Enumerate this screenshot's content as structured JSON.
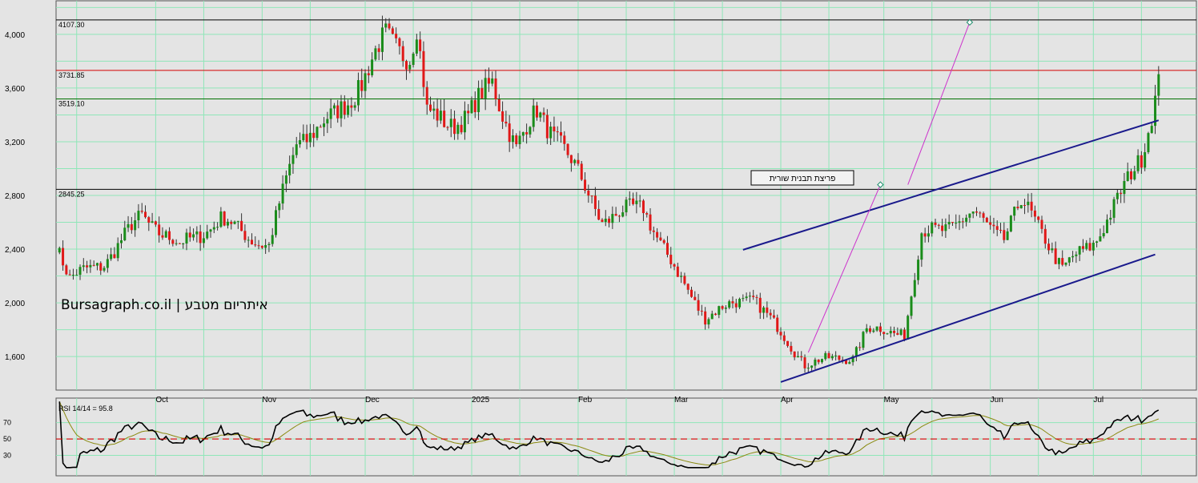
{
  "chart_data": [
    {
      "type": "candlestick",
      "title": "",
      "watermark": "Bursagraph.co.il | איתריום מטבע",
      "annotation": "פריצת תבנית שורית",
      "y_ticks": [
        "4,000",
        "3,600",
        "3,200",
        "2,800",
        "2,400",
        "2,000",
        "1,600"
      ],
      "y_tick_values": [
        4000,
        3600,
        3200,
        2800,
        2400,
        2000,
        1600
      ],
      "ylim": [
        1350,
        4250
      ],
      "x_labels": [
        "Oct",
        "Nov",
        "Dec",
        "2025",
        "Feb",
        "Mar",
        "Apr",
        "May",
        "Jun",
        "Jul"
      ],
      "x_label_dates": [
        "2024-10-01",
        "2024-11-01",
        "2024-12-01",
        "2025-01-01",
        "2025-02-01",
        "2025-03-01",
        "2025-04-01",
        "2025-05-01",
        "2025-06-01",
        "2025-07-01"
      ],
      "xlim": [
        "2024-09-02",
        "2025-07-31"
      ],
      "grid": true,
      "levels": [
        {
          "label": "4107.30",
          "value": 4107.3,
          "color": "#000000"
        },
        {
          "label": "3731.85",
          "value": 3731.85,
          "color": "#d40000"
        },
        {
          "label": "3519.10",
          "value": 3519.1,
          "color": "#007000"
        },
        {
          "label": "2845.25",
          "value": 2845.25,
          "color": "#000000"
        }
      ],
      "channel": {
        "color": "#1a1a8c",
        "upper": [
          [
            "2025-03-21",
            2395
          ],
          [
            "2025-07-20",
            3360
          ]
        ],
        "lower": [
          [
            "2025-04-01",
            1410
          ],
          [
            "2025-07-19",
            2360
          ]
        ]
      },
      "target_lines": {
        "color": "#cc33cc",
        "lines": [
          [
            [
              "2025-04-09",
              1630
            ],
            [
              "2025-04-30",
              2880
            ]
          ],
          [
            [
              "2025-05-08",
              2880
            ],
            [
              "2025-05-26",
              4090
            ]
          ]
        ]
      },
      "price_anchor_points": [
        [
          "2024-09-02",
          2460
        ],
        [
          "2024-09-06",
          2180
        ],
        [
          "2024-09-16",
          2300
        ],
        [
          "2024-09-27",
          2650
        ],
        [
          "2024-10-08",
          2420
        ],
        [
          "2024-10-20",
          2620
        ],
        [
          "2024-10-28",
          2500
        ],
        [
          "2024-11-03",
          2420
        ],
        [
          "2024-11-11",
          3200
        ],
        [
          "2024-11-22",
          3380
        ],
        [
          "2024-11-30",
          3650
        ],
        [
          "2024-12-07",
          3980
        ],
        [
          "2024-12-14",
          3850
        ],
        [
          "2024-12-16",
          4050
        ],
        [
          "2024-12-19",
          3400
        ],
        [
          "2024-12-26",
          3350
        ],
        [
          "2024-12-31",
          3380
        ],
        [
          "2025-01-07",
          3650
        ],
        [
          "2025-01-14",
          3150
        ],
        [
          "2025-01-20",
          3420
        ],
        [
          "2025-01-27",
          3200
        ],
        [
          "2025-02-03",
          2850
        ],
        [
          "2025-02-08",
          2620
        ],
        [
          "2025-02-20",
          2720
        ],
        [
          "2025-02-25",
          2450
        ],
        [
          "2025-03-02",
          2200
        ],
        [
          "2025-03-10",
          1900
        ],
        [
          "2025-03-24",
          2050
        ],
        [
          "2025-03-31",
          1800
        ],
        [
          "2025-04-08",
          1550
        ],
        [
          "2025-04-22",
          1600
        ],
        [
          "2025-04-26",
          1800
        ],
        [
          "2025-05-07",
          1780
        ],
        [
          "2025-05-12",
          2500
        ],
        [
          "2025-05-27",
          2650
        ],
        [
          "2025-06-05",
          2500
        ],
        [
          "2025-06-10",
          2750
        ],
        [
          "2025-06-17",
          2500
        ],
        [
          "2025-06-22",
          2250
        ],
        [
          "2025-07-01",
          2450
        ],
        [
          "2025-07-09",
          2800
        ],
        [
          "2025-07-15",
          3100
        ],
        [
          "2025-07-20",
          3650
        ]
      ]
    },
    {
      "type": "line",
      "title": "RSI 14/14 = 95.8",
      "y_ticks": [
        "70",
        "50",
        "30"
      ],
      "y_tick_values": [
        70,
        50,
        30
      ],
      "ylim": [
        5,
        100
      ],
      "reference_level": {
        "value": 50,
        "color": "#d40000",
        "style": "dashed"
      },
      "series": [
        {
          "values_from": "price",
          "period": 14,
          "color": "#000000"
        },
        {
          "values_from": "rsi",
          "period": 14,
          "color": "#8a8a10"
        }
      ]
    }
  ]
}
